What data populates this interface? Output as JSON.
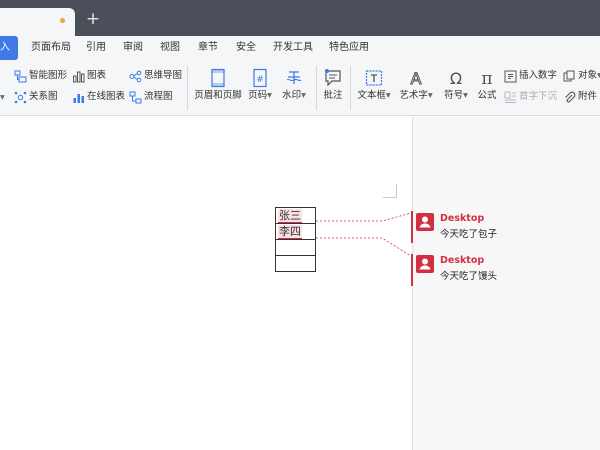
{
  "menu": {
    "items": [
      "入",
      "页面布局",
      "引用",
      "审阅",
      "视图",
      "章节",
      "安全",
      "开发工具",
      "特色应用"
    ]
  },
  "ribbon": {
    "smart_shape": "智能图形",
    "chart": "图表",
    "mind_map": "思维导图",
    "relation": "关系图",
    "online_chart": "在线图表",
    "flowchart": "流程图",
    "header_footer": "页眉和页脚",
    "page_number": "页码",
    "watermark": "水印",
    "comment": "批注",
    "text_box": "文本框",
    "word_art": "艺术字",
    "symbol": "符号",
    "formula": "公式",
    "insert_number": "插入数字",
    "drop_cap": "首字下沉",
    "object": "对象",
    "attachment": "附件",
    "dropdown_glyph": "▾",
    "formula_glyph": "π",
    "symbol_glyph": "Ω",
    "wordart_glyph": "A",
    "page_num_glyph": "#"
  },
  "document": {
    "table_rows": [
      "张三",
      "李四",
      "",
      ""
    ]
  },
  "comments": [
    {
      "author": "Desktop",
      "text": "今天吃了包子"
    },
    {
      "author": "Desktop",
      "text": "今天吃了馒头"
    }
  ],
  "colors": {
    "accent": "#3f7ae8",
    "comment_red": "#d22f43",
    "tab_dot": "#f0a23c"
  }
}
